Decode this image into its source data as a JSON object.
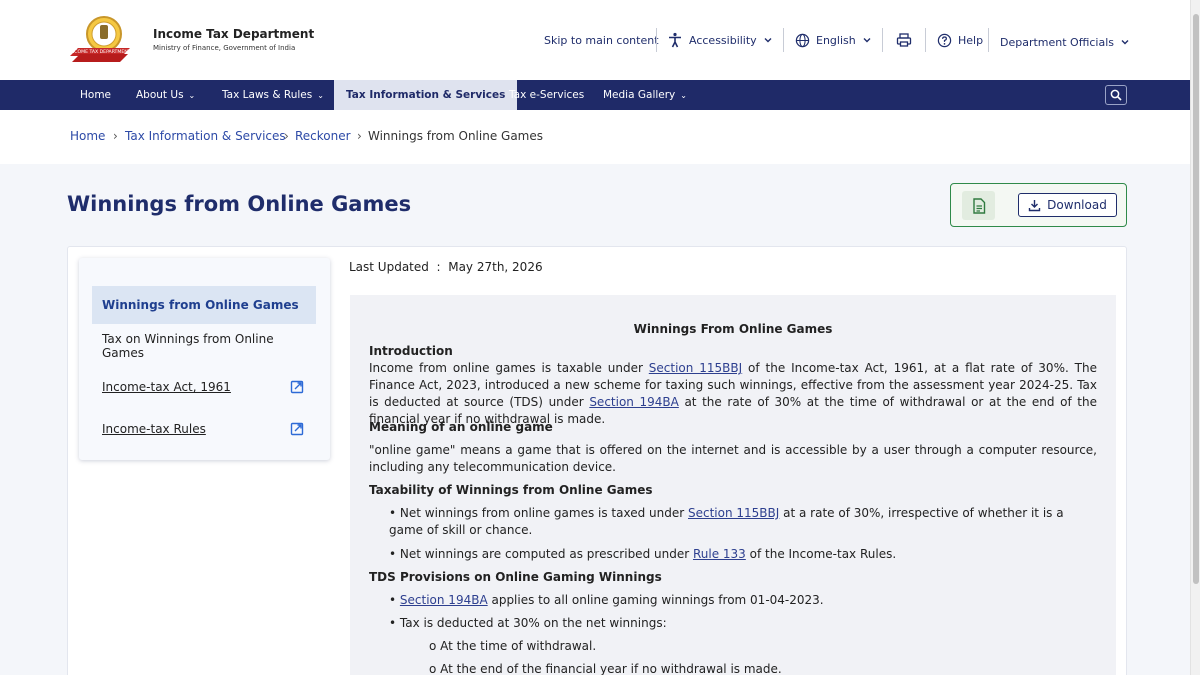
{
  "header": {
    "title": "Income Tax Department",
    "subtitle": "Ministry of Finance, Government of India",
    "logo_text": "INCOME TAX DEPARTMENT",
    "skip": "Skip to main content",
    "accessibility": "Accessibility",
    "language": "English",
    "help": "Help",
    "officials": "Department Officials"
  },
  "nav": {
    "items": [
      {
        "label": "Home"
      },
      {
        "label": "About Us"
      },
      {
        "label": "Tax Laws & Rules"
      },
      {
        "label": "Tax Information & Services"
      },
      {
        "label": "Tax e-Services"
      },
      {
        "label": "Media Gallery"
      }
    ]
  },
  "breadcrumb": [
    "Home",
    "Tax Information & Services",
    "Reckoner",
    "Winnings from Online Games"
  ],
  "page": {
    "title": "Winnings from Online Games",
    "download": "Download",
    "updated_label": "Last Updated",
    "updated_sep": ":",
    "updated_value": "May 27th, 2026"
  },
  "sidebar": {
    "items": [
      {
        "label": "Winnings from Online Games"
      },
      {
        "label": "Tax on Winnings from Online Games"
      },
      {
        "label": "Income-tax Act, 1961"
      },
      {
        "label": "Income-tax Rules"
      }
    ]
  },
  "content": {
    "heading": "Winnings From Online Games",
    "intro_head": "Introduction",
    "intro_p1": "Income from online games is taxable under ",
    "intro_link1": "Section 115BBJ",
    "intro_p2": " of the Income-tax Act, 1961, at a flat rate of 30%. The Finance Act, 2023, introduced a new scheme for taxing such winnings, effective from the assessment year 2024-25. Tax is deducted at source (TDS) under ",
    "intro_link2": "Section 194BA",
    "intro_p3": " at the rate of 30% at the time of withdrawal or at the end of the financial year if no withdrawal is made.",
    "meaning_head": "Meaning of an online game",
    "meaning_p": "\"online game\" means a game that is offered on the internet and is accessible by a user through a computer resource, including any telecommunication device.",
    "tax_head": "Taxability of Winnings from Online Games",
    "b1_a": "Net winnings from online games is taxed under ",
    "b1_link": "Section 115BBJ",
    "b1_b": " at a rate of 30%, irrespective of whether it is a game of skill or chance.",
    "b2_a": "Net winnings are computed as prescribed under ",
    "b2_link": "Rule 133",
    "b2_b": " of the Income-tax Rules.",
    "tds_head": "TDS Provisions on Online Gaming Winnings",
    "b3_link": "Section 194BA",
    "b3_b": " applies to all online gaming winnings from 01-04-2023.",
    "b4": "Tax is deducted at 30% on the net winnings:",
    "sub1": "o At the time of withdrawal.",
    "sub2": "o At the end of the financial year if no withdrawal is made."
  },
  "colors": {
    "nav_bg": "#1f2a68",
    "title": "#1f2d6b",
    "link": "#2d4aa7",
    "download_border": "#2f8a4a"
  }
}
